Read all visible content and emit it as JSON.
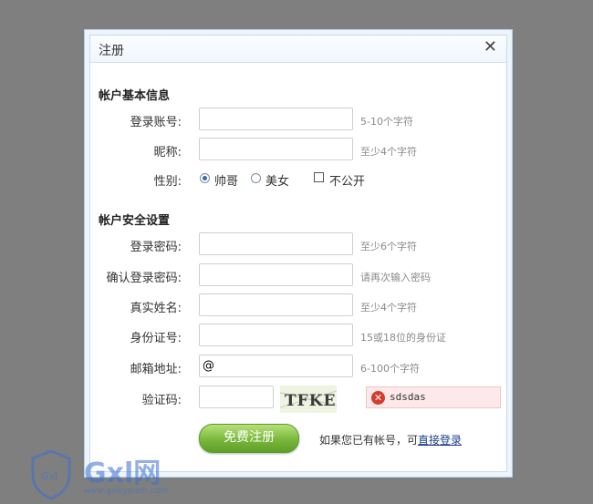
{
  "dialog": {
    "title": "注册",
    "close_glyph": "✕"
  },
  "basic_section": {
    "title": "帐户基本信息",
    "fields": [
      {
        "label": "登录账号:",
        "value": "",
        "hint": "5-10个字符"
      },
      {
        "label": "昵称:",
        "value": "",
        "hint": "至少4个字符"
      }
    ],
    "gender": {
      "label": "性别:",
      "options": [
        "帅哥",
        "美女"
      ],
      "selected": "帅哥",
      "private_label": "不公开",
      "private_checked": false
    }
  },
  "security_section": {
    "title": "帐户安全设置",
    "fields": [
      {
        "label": "登录密码:",
        "value": "",
        "hint": "至少6个字符"
      },
      {
        "label": "确认登录密码:",
        "value": "",
        "hint": "请再次输入密码"
      },
      {
        "label": "真实姓名:",
        "value": "",
        "hint": "至少4个字符"
      },
      {
        "label": "身份证号:",
        "value": "",
        "hint": "15或18位的身份证"
      },
      {
        "label": "邮箱地址:",
        "value": "@",
        "hint": "6-100个字符"
      }
    ],
    "captcha": {
      "label": "验证码:",
      "value": "",
      "image_text": "TFKE",
      "error_text": "sdsdas"
    }
  },
  "actions": {
    "submit_label": "免费注册",
    "login_prompt": "如果您已有帐号，可",
    "login_link": "直接登录"
  },
  "watermark": {
    "brand": "Gxl网",
    "url": "www.gxlsystem.com"
  },
  "colors": {
    "accent": "#2e6db4",
    "submit_green": "#79b83b",
    "error_red": "#d63a2a"
  }
}
